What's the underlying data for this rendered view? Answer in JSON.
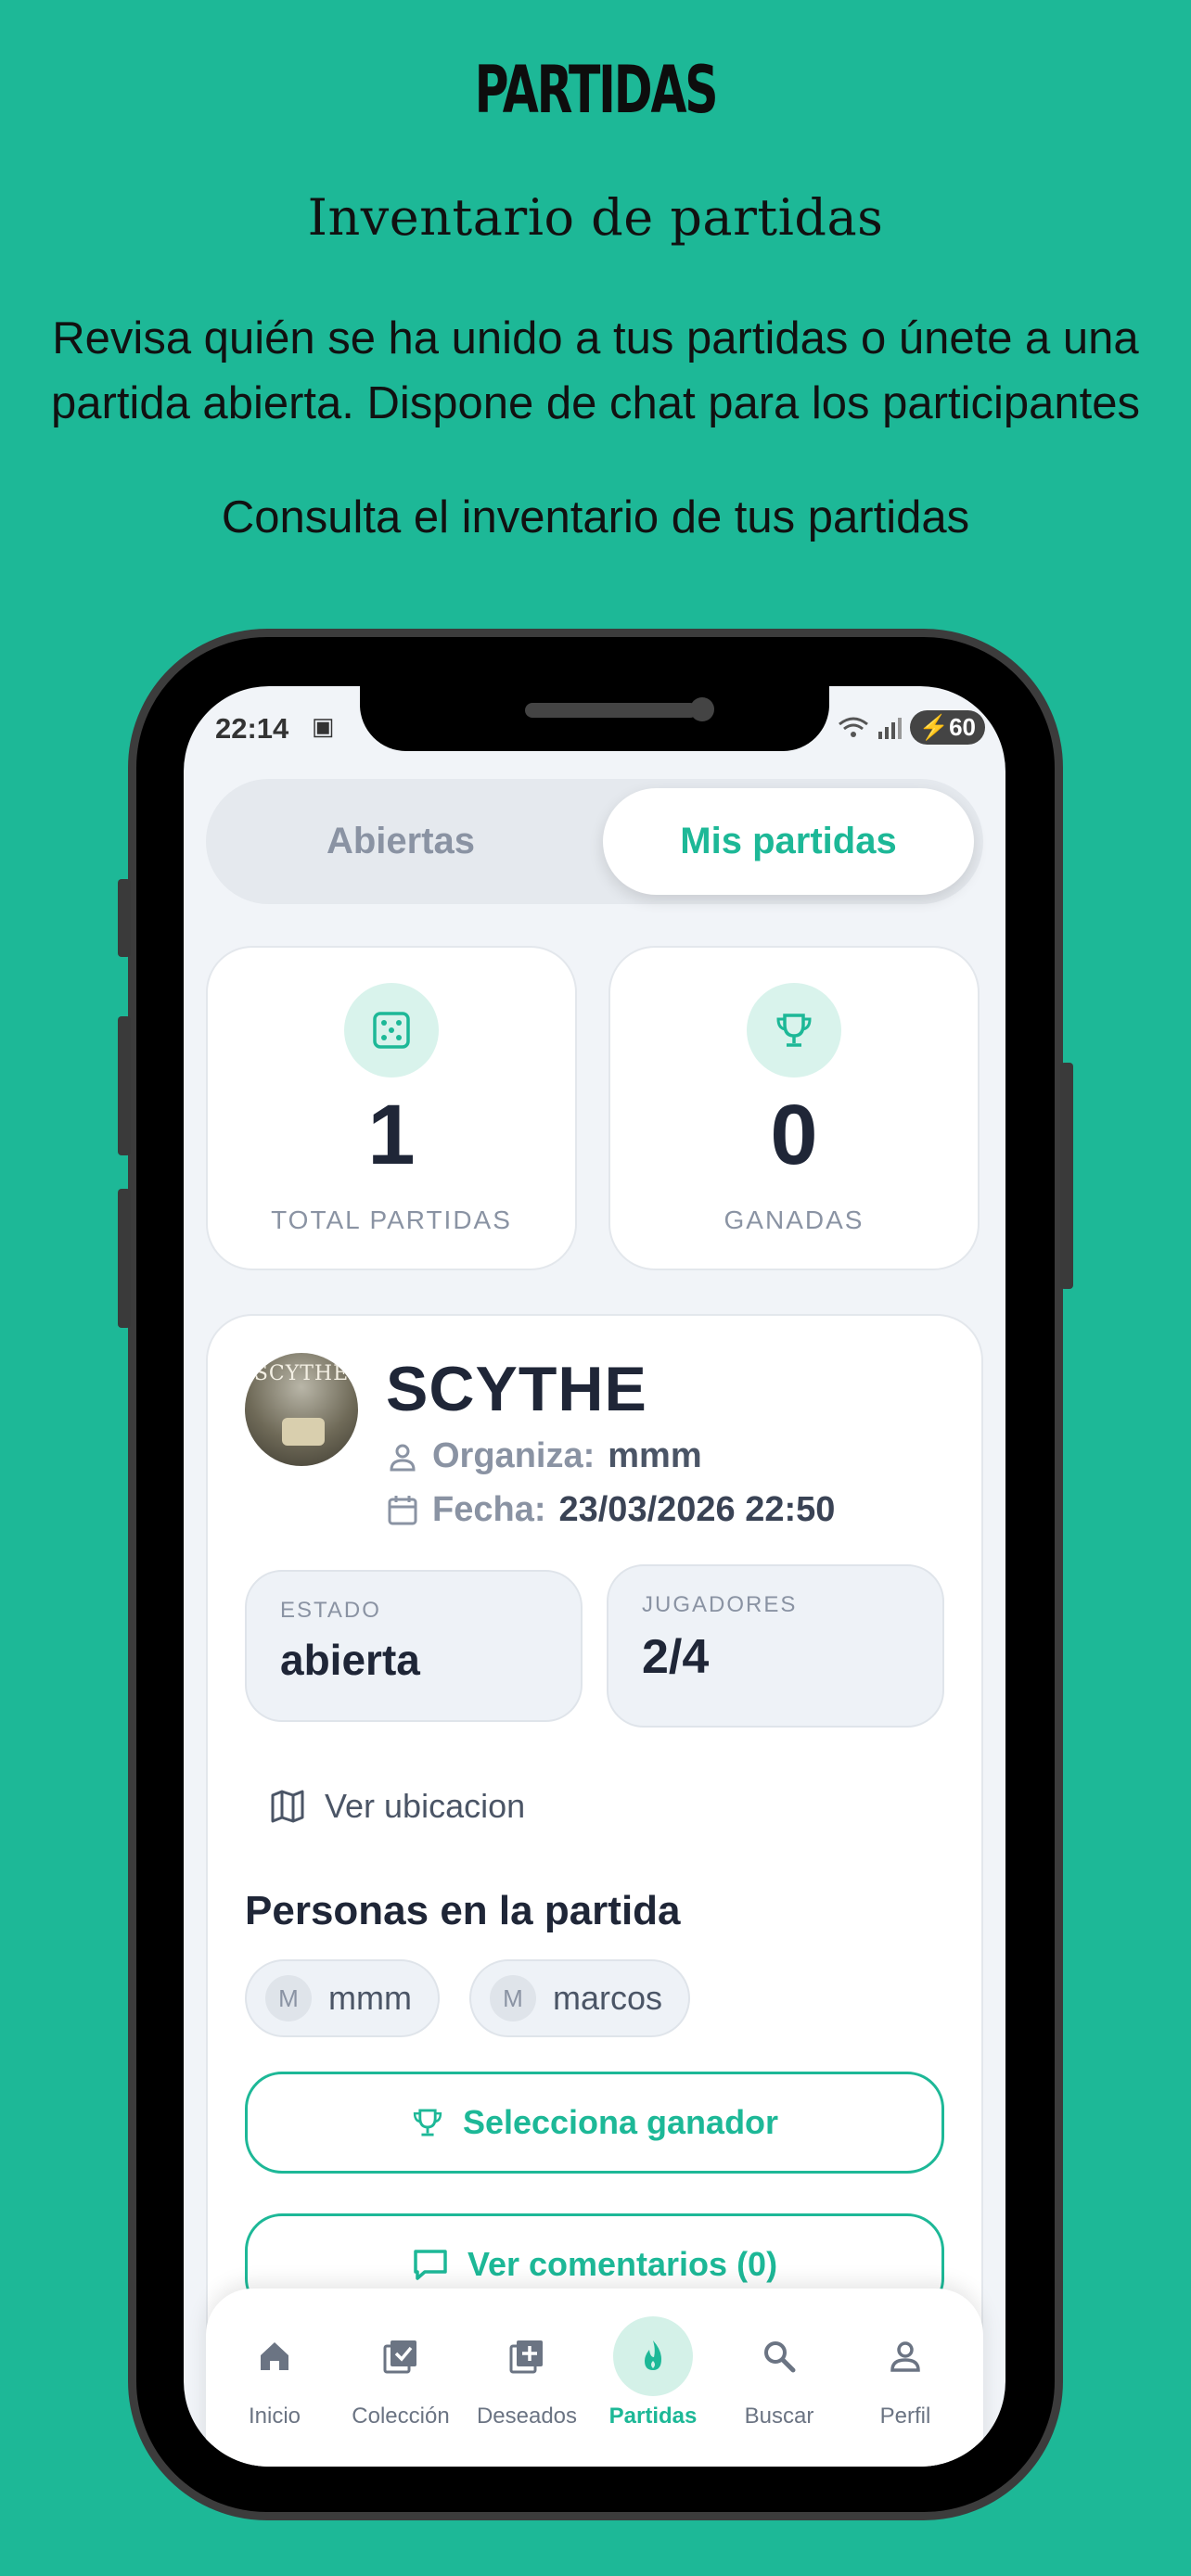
{
  "promo": {
    "title": "PARTIDAS",
    "subtitle": "Inventario de partidas",
    "description": "Revisa quién se ha unido a tus partidas o únete a una partida abierta. Dispone de chat para los participantes",
    "subtitle2": "Consulta el inventario de tus partidas"
  },
  "status_bar": {
    "time": "22:14",
    "battery": "60"
  },
  "tabs": [
    {
      "label": "Abiertas",
      "active": false
    },
    {
      "label": "Mis partidas",
      "active": true
    }
  ],
  "stats": {
    "total": {
      "value": "1",
      "label": "TOTAL PARTIDAS",
      "icon": "dice-icon"
    },
    "won": {
      "value": "0",
      "label": "GANADAS",
      "icon": "trophy-icon"
    }
  },
  "game": {
    "thumb_text": "SCYTHE",
    "name": "SCYTHE",
    "organizer_label": "Organiza:",
    "organizer": "mmm",
    "date_label": "Fecha:",
    "date": "23/03/2026 22:50",
    "status_label": "ESTADO",
    "status": "abierta",
    "players_label": "JUGADORES",
    "players": "2/4",
    "location_link": "Ver ubicacion",
    "people_title": "Personas en la partida",
    "participants": [
      {
        "initial": "M",
        "name": "mmm"
      },
      {
        "initial": "M",
        "name": "marcos"
      }
    ],
    "select_winner": "Selecciona ganador",
    "comments": "Ver comentarios (0)"
  },
  "nav": [
    {
      "label": "Inicio",
      "icon": "home-icon",
      "active": false
    },
    {
      "label": "Colección",
      "icon": "collection-icon",
      "active": false
    },
    {
      "label": "Deseados",
      "icon": "wishlist-icon",
      "active": false
    },
    {
      "label": "Partidas",
      "icon": "flame-icon",
      "active": true
    },
    {
      "label": "Buscar",
      "icon": "search-icon",
      "active": false
    },
    {
      "label": "Perfil",
      "icon": "profile-icon",
      "active": false
    }
  ],
  "colors": {
    "accent": "#1db897",
    "background": "#1db897",
    "text_dark": "#1f2637",
    "muted": "#8a93a3"
  }
}
